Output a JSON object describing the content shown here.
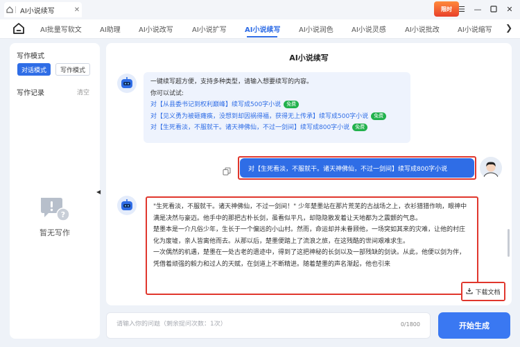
{
  "window": {
    "tab_title": "AI小说续写",
    "badge_text": "限时",
    "icons": [
      "home-icon",
      "close-icon",
      "menu-icon",
      "minimize-icon",
      "maximize-icon",
      "window-close-icon"
    ]
  },
  "nav": {
    "tabs": [
      "AI批量写软文",
      "AI助理",
      "AI小说改写",
      "AI小说扩写",
      "AI小说续写",
      "AI小说润色",
      "AI小说灵感",
      "AI小说批改",
      "AI小说缩写"
    ],
    "active_tab": "AI小说续写"
  },
  "sidebar": {
    "mode_heading": "写作模式",
    "mode_chat": "对话模式",
    "mode_write": "写作模式",
    "records_heading": "写作记录",
    "clear_label": "清空",
    "empty_text": "暂无写作"
  },
  "main": {
    "title": "AI小说续写",
    "bot_intro": "一键续写超方便，支持多种类型，请输入想要续写的内容。",
    "try_label": "你可以试试:",
    "suggestions": [
      {
        "text": "对【从县委书记到权利巅峰】续写成500字小说",
        "badge": "免费"
      },
      {
        "text": "对【见义勇为被砸瘫痪，没想到却因祸得福，获得无上传承】续写成500字小说",
        "badge": "免费"
      },
      {
        "text": "对【生死看淡，不服就干。诸天神佛仙，不过一剑间】续写成800字小说",
        "badge": "免费"
      }
    ],
    "user_message": "对【生死看淡，不服就干。诸天神佛仙，不过一剑间】续写成800字小说",
    "answer_paragraphs": [
      "\"生死看淡，不服就干。诸天神佛仙，不过一剑间！\" 少年楚墨站在那片荒芜的古战场之上，衣衫猎猎作响，眼神中满是决然与豪迈。他手中的那把古朴长剑，虽看似平凡，却隐隐散发着让天地都为之震颤的气息。",
      "楚墨本是一介凡俗少年，生长于一个偏远的小山村。然而，命运却并未眷顾他，一场突如其来的灾难，让他的村庄化为废墟，亲人皆离他而去。从那以后，楚墨便踏上了流浪之旅，在这残酷的世间艰难求生。",
      "一次偶然的机遇，楚墨在一处古老的遗迹中，得到了这把神秘的长剑以及一部残缺的剑诀。从此，他便以剑为伴，凭借着顽强的毅力和过人的天赋，在剑道上不断精进。随着楚墨的声名渐起，他也引来"
    ],
    "download_label": "下载文档"
  },
  "input": {
    "placeholder": "请输入你的问题（剩余提问次数：1次）",
    "char_count": "0/1800",
    "generate_label": "开始生成"
  }
}
